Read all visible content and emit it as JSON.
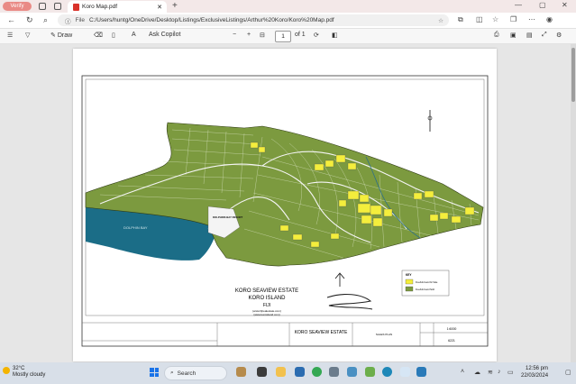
{
  "browser": {
    "profile_label": "Verify",
    "tab_title": "Koro Map.pdf",
    "address_scheme": "File",
    "address_path": "C:/Users/huntg/OneDrive/Desktop/Listings/ExclusiveListings/Arthur%20Koro/Koro%20Map.pdf"
  },
  "pdf_toolbar": {
    "draw_label": "Draw",
    "copilot_label": "Ask Copilot",
    "zoom_out": "−",
    "zoom_in": "+",
    "page_current": "1",
    "page_total": "of 1"
  },
  "map": {
    "title_line1": "KORO SEAVIEW ESTATE",
    "title_line2": "KORO ISLAND",
    "title_line3": "FIJI",
    "web1": "(www.fijirealestate.com)",
    "web2": "(www.koroisland.com)",
    "resort_label": "DOLPHINS BAY RESORT",
    "bay_label": "DOLPHIN BAY",
    "legend_title": "KEY",
    "legend_yellow": "Freehold Land for Sale",
    "legend_green": "Freehold Land Sold",
    "tb_name": "KORO SEAVIEW ESTATE",
    "tb_sheet": "SALES PLAN",
    "tb_scale": "1:6000",
    "tb_number": "6221",
    "colors": {
      "green": "#7c9a3f",
      "yellow": "#f4ee3c",
      "sea": "#1b6d87"
    }
  },
  "taskbar": {
    "temperature": "32°C",
    "weather": "Mostly cloudy",
    "search_label": "Search",
    "time": "12:56 pm",
    "date": "22/03/2024"
  }
}
